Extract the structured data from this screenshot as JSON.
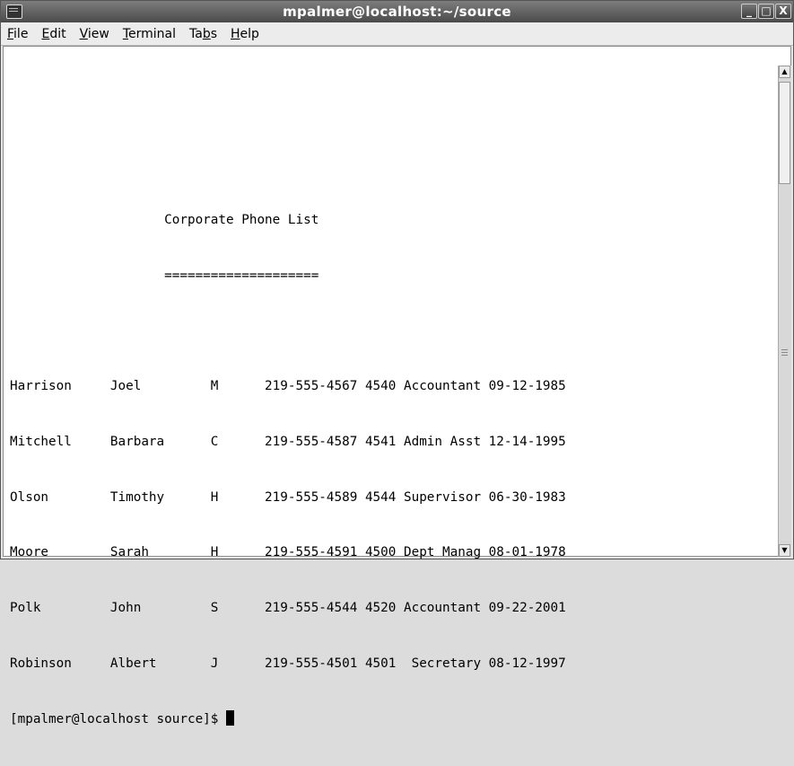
{
  "window": {
    "title": "mpalmer@localhost:~/source"
  },
  "menubar": {
    "items": [
      {
        "label": "File",
        "mnemonic": "F",
        "rest": "ile"
      },
      {
        "label": "Edit",
        "mnemonic": "E",
        "rest": "dit"
      },
      {
        "label": "View",
        "mnemonic": "V",
        "rest": "iew"
      },
      {
        "label": "Terminal",
        "mnemonic": "T",
        "rest": "erminal"
      },
      {
        "label": "Tabs",
        "prefix": "Ta",
        "mnemonic": "b",
        "rest": "s"
      },
      {
        "label": "Help",
        "mnemonic": "H",
        "rest": "elp"
      }
    ]
  },
  "terminal": {
    "lines": [
      "",
      "",
      "                    Corporate Phone List",
      "                    ====================",
      "",
      "Harrison     Joel         M      219-555-4567 4540 Accountant 09-12-1985",
      "Mitchell     Barbara      C      219-555-4587 4541 Admin Asst 12-14-1995",
      "Olson        Timothy      H      219-555-4589 4544 Supervisor 06-30-1983",
      "Moore        Sarah        H      219-555-4591 4500 Dept Manag 08-01-1978",
      "Polk         John         S      219-555-4544 4520 Accountant 09-22-2001",
      "Robinson     Albert       J      219-555-4501 4501  Secretary 08-12-1997"
    ],
    "prompt": "[mpalmer@localhost source]$ "
  },
  "icons": {
    "window_icon": "terminal-icon",
    "minimize": "minimize-icon",
    "maximize": "maximize-icon",
    "close": "close-icon"
  }
}
